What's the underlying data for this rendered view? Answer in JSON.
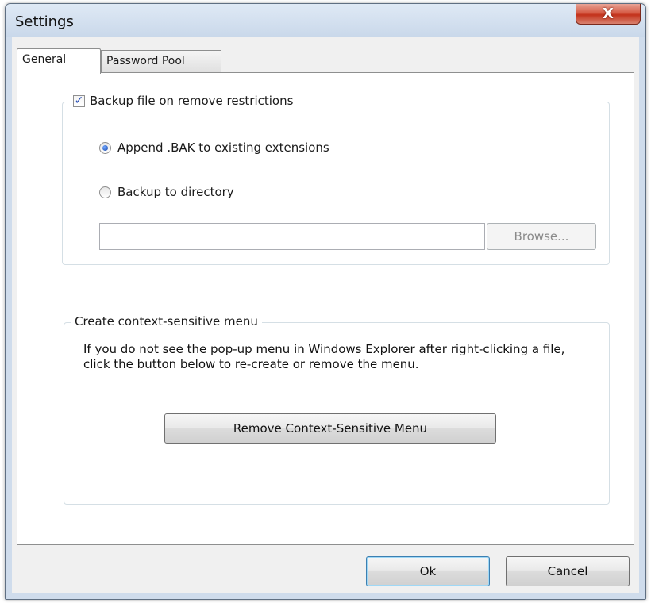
{
  "window": {
    "title": "Settings",
    "close_label": "X"
  },
  "tabs": [
    {
      "label": "General",
      "active": true
    },
    {
      "label": "Password Pool",
      "active": false
    }
  ],
  "backup": {
    "checkbox_label": "Backup file on remove restrictions",
    "checked": true,
    "option_append": "Append .BAK to existing extensions",
    "option_directory": "Backup to directory",
    "selected_option": "append",
    "directory_value": "",
    "browse_label": "Browse..."
  },
  "context_menu": {
    "group_title": "Create context-sensitive menu",
    "description": "If you do not see the pop-up menu in Windows Explorer after right-clicking a file, click the button below to re-create or remove the menu.",
    "button_label": "Remove Context-Sensitive Menu"
  },
  "footer": {
    "ok_label": "Ok",
    "cancel_label": "Cancel"
  },
  "colors": {
    "accent": "#1d4aa8",
    "close": "#c2321b",
    "frame": "#cfdcec"
  }
}
